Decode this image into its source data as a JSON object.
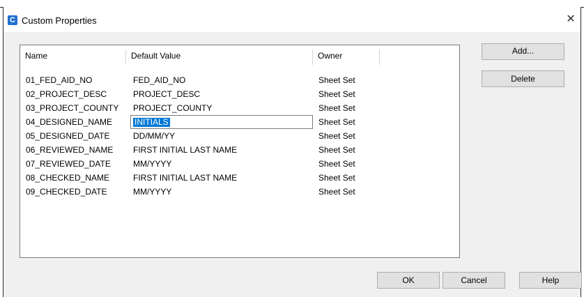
{
  "window": {
    "title": "Custom Properties",
    "app_icon": "C",
    "close_glyph": "✕"
  },
  "columns": [
    "Name",
    "Default Value",
    "Owner"
  ],
  "rows": [
    {
      "name": "01_FED_AID_NO",
      "value": "FED_AID_NO",
      "owner": "Sheet Set"
    },
    {
      "name": "02_PROJECT_DESC",
      "value": "PROJECT_DESC",
      "owner": "Sheet Set"
    },
    {
      "name": "03_PROJECT_COUNTY",
      "value": "PROJECT_COUNTY",
      "owner": "Sheet Set"
    },
    {
      "name": "04_DESIGNED_NAME",
      "value": "INITIALS",
      "owner": "Sheet Set",
      "editing": true
    },
    {
      "name": "05_DESIGNED_DATE",
      "value": "DD/MM/YY",
      "owner": "Sheet Set"
    },
    {
      "name": "06_REVIEWED_NAME",
      "value": "FIRST INITIAL LAST NAME",
      "owner": "Sheet Set"
    },
    {
      "name": "07_REVIEWED_DATE",
      "value": "MM/YYYY",
      "owner": "Sheet Set"
    },
    {
      "name": "08_CHECKED_NAME",
      "value": "FIRST INITIAL LAST NAME",
      "owner": "Sheet Set"
    },
    {
      "name": "09_CHECKED_DATE",
      "value": "MM/YYYY",
      "owner": "Sheet Set"
    }
  ],
  "buttons": {
    "add": "Add...",
    "delete": "Delete",
    "ok": "OK",
    "cancel": "Cancel",
    "help": "Help"
  },
  "colors": {
    "selection": "#0078d7",
    "app_icon": "#1f6fd0",
    "dialog_bg": "#f0f0f0"
  }
}
